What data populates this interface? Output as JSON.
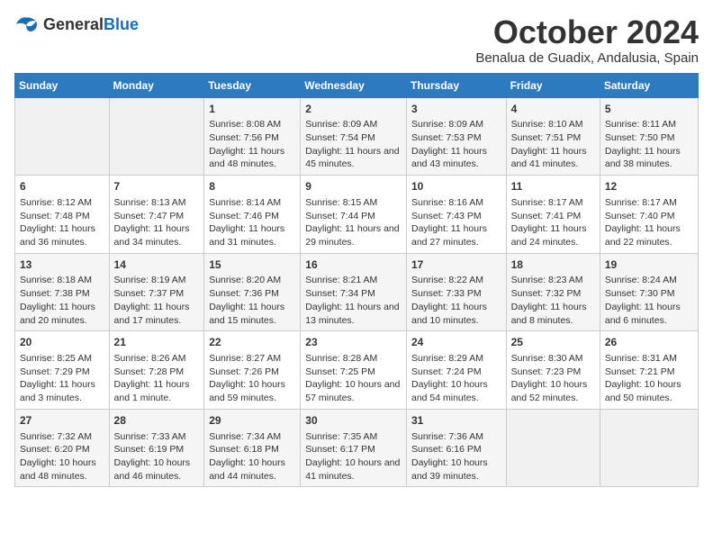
{
  "header": {
    "logo_general": "General",
    "logo_blue": "Blue",
    "month_year": "October 2024",
    "location": "Benalua de Guadix, Andalusia, Spain"
  },
  "days_of_week": [
    "Sunday",
    "Monday",
    "Tuesday",
    "Wednesday",
    "Thursday",
    "Friday",
    "Saturday"
  ],
  "weeks": [
    [
      {
        "day": "",
        "info": ""
      },
      {
        "day": "",
        "info": ""
      },
      {
        "day": "1",
        "info": "Sunrise: 8:08 AM\nSunset: 7:56 PM\nDaylight: 11 hours and 48 minutes."
      },
      {
        "day": "2",
        "info": "Sunrise: 8:09 AM\nSunset: 7:54 PM\nDaylight: 11 hours and 45 minutes."
      },
      {
        "day": "3",
        "info": "Sunrise: 8:09 AM\nSunset: 7:53 PM\nDaylight: 11 hours and 43 minutes."
      },
      {
        "day": "4",
        "info": "Sunrise: 8:10 AM\nSunset: 7:51 PM\nDaylight: 11 hours and 41 minutes."
      },
      {
        "day": "5",
        "info": "Sunrise: 8:11 AM\nSunset: 7:50 PM\nDaylight: 11 hours and 38 minutes."
      }
    ],
    [
      {
        "day": "6",
        "info": "Sunrise: 8:12 AM\nSunset: 7:48 PM\nDaylight: 11 hours and 36 minutes."
      },
      {
        "day": "7",
        "info": "Sunrise: 8:13 AM\nSunset: 7:47 PM\nDaylight: 11 hours and 34 minutes."
      },
      {
        "day": "8",
        "info": "Sunrise: 8:14 AM\nSunset: 7:46 PM\nDaylight: 11 hours and 31 minutes."
      },
      {
        "day": "9",
        "info": "Sunrise: 8:15 AM\nSunset: 7:44 PM\nDaylight: 11 hours and 29 minutes."
      },
      {
        "day": "10",
        "info": "Sunrise: 8:16 AM\nSunset: 7:43 PM\nDaylight: 11 hours and 27 minutes."
      },
      {
        "day": "11",
        "info": "Sunrise: 8:17 AM\nSunset: 7:41 PM\nDaylight: 11 hours and 24 minutes."
      },
      {
        "day": "12",
        "info": "Sunrise: 8:17 AM\nSunset: 7:40 PM\nDaylight: 11 hours and 22 minutes."
      }
    ],
    [
      {
        "day": "13",
        "info": "Sunrise: 8:18 AM\nSunset: 7:38 PM\nDaylight: 11 hours and 20 minutes."
      },
      {
        "day": "14",
        "info": "Sunrise: 8:19 AM\nSunset: 7:37 PM\nDaylight: 11 hours and 17 minutes."
      },
      {
        "day": "15",
        "info": "Sunrise: 8:20 AM\nSunset: 7:36 PM\nDaylight: 11 hours and 15 minutes."
      },
      {
        "day": "16",
        "info": "Sunrise: 8:21 AM\nSunset: 7:34 PM\nDaylight: 11 hours and 13 minutes."
      },
      {
        "day": "17",
        "info": "Sunrise: 8:22 AM\nSunset: 7:33 PM\nDaylight: 11 hours and 10 minutes."
      },
      {
        "day": "18",
        "info": "Sunrise: 8:23 AM\nSunset: 7:32 PM\nDaylight: 11 hours and 8 minutes."
      },
      {
        "day": "19",
        "info": "Sunrise: 8:24 AM\nSunset: 7:30 PM\nDaylight: 11 hours and 6 minutes."
      }
    ],
    [
      {
        "day": "20",
        "info": "Sunrise: 8:25 AM\nSunset: 7:29 PM\nDaylight: 11 hours and 3 minutes."
      },
      {
        "day": "21",
        "info": "Sunrise: 8:26 AM\nSunset: 7:28 PM\nDaylight: 11 hours and 1 minute."
      },
      {
        "day": "22",
        "info": "Sunrise: 8:27 AM\nSunset: 7:26 PM\nDaylight: 10 hours and 59 minutes."
      },
      {
        "day": "23",
        "info": "Sunrise: 8:28 AM\nSunset: 7:25 PM\nDaylight: 10 hours and 57 minutes."
      },
      {
        "day": "24",
        "info": "Sunrise: 8:29 AM\nSunset: 7:24 PM\nDaylight: 10 hours and 54 minutes."
      },
      {
        "day": "25",
        "info": "Sunrise: 8:30 AM\nSunset: 7:23 PM\nDaylight: 10 hours and 52 minutes."
      },
      {
        "day": "26",
        "info": "Sunrise: 8:31 AM\nSunset: 7:21 PM\nDaylight: 10 hours and 50 minutes."
      }
    ],
    [
      {
        "day": "27",
        "info": "Sunrise: 7:32 AM\nSunset: 6:20 PM\nDaylight: 10 hours and 48 minutes."
      },
      {
        "day": "28",
        "info": "Sunrise: 7:33 AM\nSunset: 6:19 PM\nDaylight: 10 hours and 46 minutes."
      },
      {
        "day": "29",
        "info": "Sunrise: 7:34 AM\nSunset: 6:18 PM\nDaylight: 10 hours and 44 minutes."
      },
      {
        "day": "30",
        "info": "Sunrise: 7:35 AM\nSunset: 6:17 PM\nDaylight: 10 hours and 41 minutes."
      },
      {
        "day": "31",
        "info": "Sunrise: 7:36 AM\nSunset: 6:16 PM\nDaylight: 10 hours and 39 minutes."
      },
      {
        "day": "",
        "info": ""
      },
      {
        "day": "",
        "info": ""
      }
    ]
  ]
}
